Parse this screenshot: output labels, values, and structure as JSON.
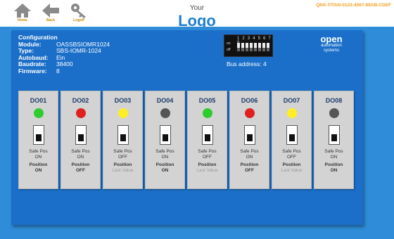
{
  "nav": {
    "home_label": "Home",
    "back_label": "Back",
    "logoff_label": "Logoff"
  },
  "logo": {
    "small": "Your",
    "big": "Logo"
  },
  "device_id": "QNX-TITAN-0123-4567-89AB-CDEF",
  "config": {
    "title": "Configuration",
    "rows": [
      {
        "key": "Module:",
        "value": "OASSBSIOMR1024"
      },
      {
        "key": "Type:",
        "value": "SBS-IOMR-1024"
      },
      {
        "key": "Autobaud:",
        "value": "Ein"
      },
      {
        "key": "Baudrate:",
        "value": "38400"
      },
      {
        "key": "Firmware:",
        "value": "8"
      }
    ]
  },
  "dip": {
    "numbers": "1 2 3 4 5 6 7 8",
    "on_label": "on",
    "off_label": "off"
  },
  "bus_address": "Bus address: 4",
  "brand": {
    "line1": "open",
    "line2": "automation",
    "line3": "systems"
  },
  "colors": {
    "green": "#2ecc2e",
    "red": "#e02020",
    "yellow": "#ffee22",
    "gray": "#555555",
    "panel": "#1b6fc9"
  },
  "outputs": [
    {
      "name": "DO01",
      "led": "green",
      "safe_pos_label": "Safe Pos",
      "safe_pos": "ON",
      "position_label": "Position",
      "position": "ON",
      "last_value": false
    },
    {
      "name": "DO02",
      "led": "red",
      "safe_pos_label": "Safe Pos",
      "safe_pos": "ON",
      "position_label": "Position",
      "position": "OFF",
      "last_value": false
    },
    {
      "name": "DO03",
      "led": "yellow",
      "safe_pos_label": "Safe Pos",
      "safe_pos": "OFF",
      "position_label": "Position",
      "position": "Last Value",
      "last_value": true
    },
    {
      "name": "DO04",
      "led": "gray",
      "safe_pos_label": "Safe Pos",
      "safe_pos": "ON",
      "position_label": "Position",
      "position": "ON",
      "last_value": false
    },
    {
      "name": "DO05",
      "led": "green",
      "safe_pos_label": "Safe Pos",
      "safe_pos": "OFF",
      "position_label": "Position",
      "position": "Last Value",
      "last_value": true
    },
    {
      "name": "DO06",
      "led": "red",
      "safe_pos_label": "Safe Pos",
      "safe_pos": "ON",
      "position_label": "Position",
      "position": "OFF",
      "last_value": false
    },
    {
      "name": "DO07",
      "led": "yellow",
      "safe_pos_label": "Safe Pos",
      "safe_pos": "OFF",
      "position_label": "Position",
      "position": "Last Value",
      "last_value": true
    },
    {
      "name": "DO08",
      "led": "gray",
      "safe_pos_label": "Safe Pos",
      "safe_pos": "ON",
      "position_label": "Position",
      "position": "ON",
      "last_value": false
    }
  ]
}
